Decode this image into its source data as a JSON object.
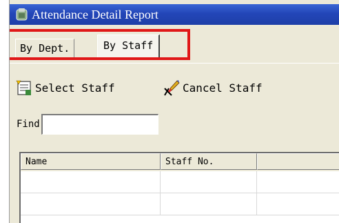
{
  "window": {
    "title": "Attendance Detail Report"
  },
  "tabs": [
    {
      "label": "By Dept.",
      "selected": false
    },
    {
      "label": "By Staff",
      "selected": true
    }
  ],
  "highlight_color": "#e01818",
  "toolbar": {
    "select_staff_label": "Select Staff",
    "cancel_staff_label": "Cancel Staff"
  },
  "find": {
    "label": "Find",
    "value": ""
  },
  "table": {
    "columns": [
      "Name",
      "Staff No.",
      ""
    ],
    "rows": [
      [
        "",
        "",
        ""
      ],
      [
        "",
        "",
        ""
      ]
    ]
  },
  "colors": {
    "titlebar": "#2346b8",
    "panel": "#ece9d8"
  }
}
